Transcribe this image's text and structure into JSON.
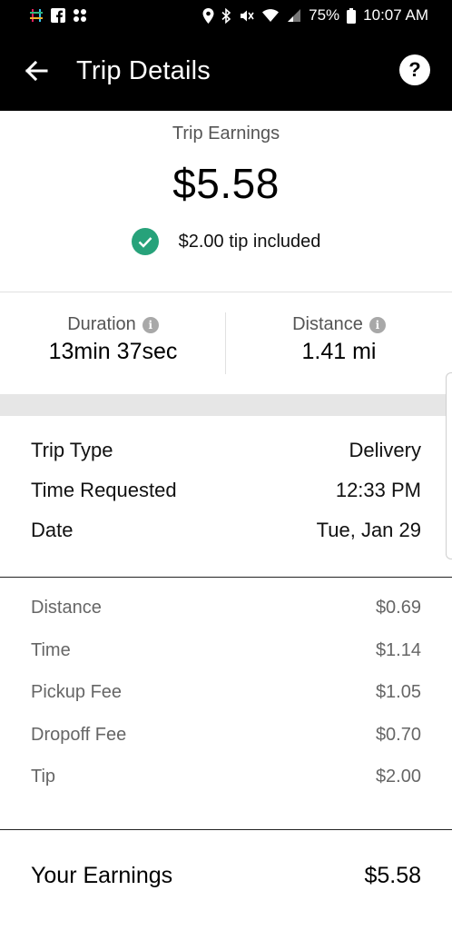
{
  "status_bar": {
    "battery": "75%",
    "time": "10:07 AM",
    "icons": [
      "slack-icon",
      "facebook-icon",
      "app-grid-icon",
      "location-icon",
      "bluetooth-icon",
      "mute-icon",
      "wifi-icon",
      "signal-icon",
      "battery-icon"
    ]
  },
  "header": {
    "title": "Trip Details",
    "back_icon": "arrow-left-icon",
    "help_label": "?"
  },
  "summary": {
    "label": "Trip Earnings",
    "amount": "$5.58",
    "tip_text": "$2.00 tip included",
    "tip_icon_color": "#27a27a"
  },
  "stats": {
    "duration_label": "Duration",
    "duration_value": "13min 37sec",
    "distance_label": "Distance",
    "distance_value": "1.41 mi"
  },
  "trip_info": [
    {
      "label": "Trip Type",
      "value": "Delivery"
    },
    {
      "label": "Time Requested",
      "value": "12:33 PM"
    },
    {
      "label": "Date",
      "value": "Tue, Jan 29"
    }
  ],
  "breakdown": [
    {
      "label": "Distance",
      "value": "$0.69"
    },
    {
      "label": "Time",
      "value": "$1.14"
    },
    {
      "label": "Pickup Fee",
      "value": "$1.05"
    },
    {
      "label": "Dropoff Fee",
      "value": "$0.70"
    },
    {
      "label": "Tip",
      "value": "$2.00"
    }
  ],
  "total": {
    "label": "Your Earnings",
    "value": "$5.58"
  }
}
